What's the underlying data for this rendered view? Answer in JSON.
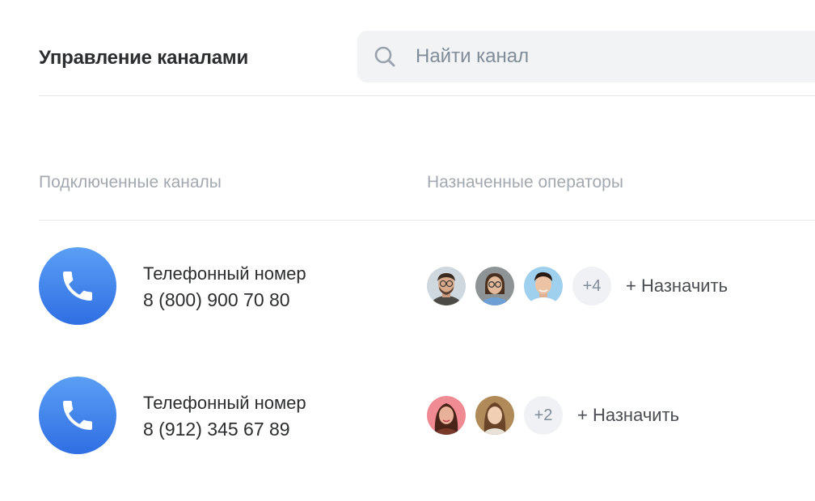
{
  "header": {
    "title": "Управление каналами",
    "search_placeholder": "Найти канал",
    "search_icon": "search-icon"
  },
  "columns": {
    "channels": "Подключенные каналы",
    "operators": "Назначенные операторы"
  },
  "channels": [
    {
      "icon": "phone-icon",
      "name": "Телефонный номер",
      "number": "8 (800) 900 70 80",
      "more": "+4",
      "assign_label": "+ Назначить"
    },
    {
      "icon": "phone-icon",
      "name": "Телефонный номер",
      "number": "8 (912) 345 67 89",
      "more": "+2",
      "assign_label": "+ Назначить"
    }
  ],
  "colors": {
    "accent": "#2f6fe3",
    "search_bg": "#f1f3f4",
    "muted_text": "#a3a9b0"
  }
}
